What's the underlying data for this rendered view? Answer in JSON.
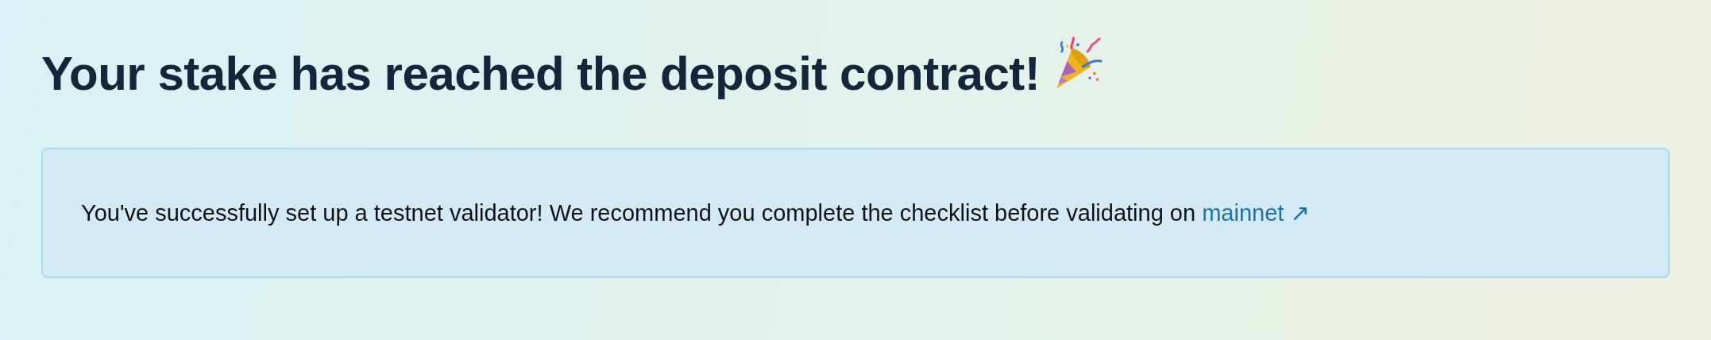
{
  "heading": "Your stake has reached the deposit contract!",
  "notice": {
    "text": "You've successfully set up a testnet validator! We recommend you complete the checklist before validating on",
    "link": "mainnet ↗"
  }
}
